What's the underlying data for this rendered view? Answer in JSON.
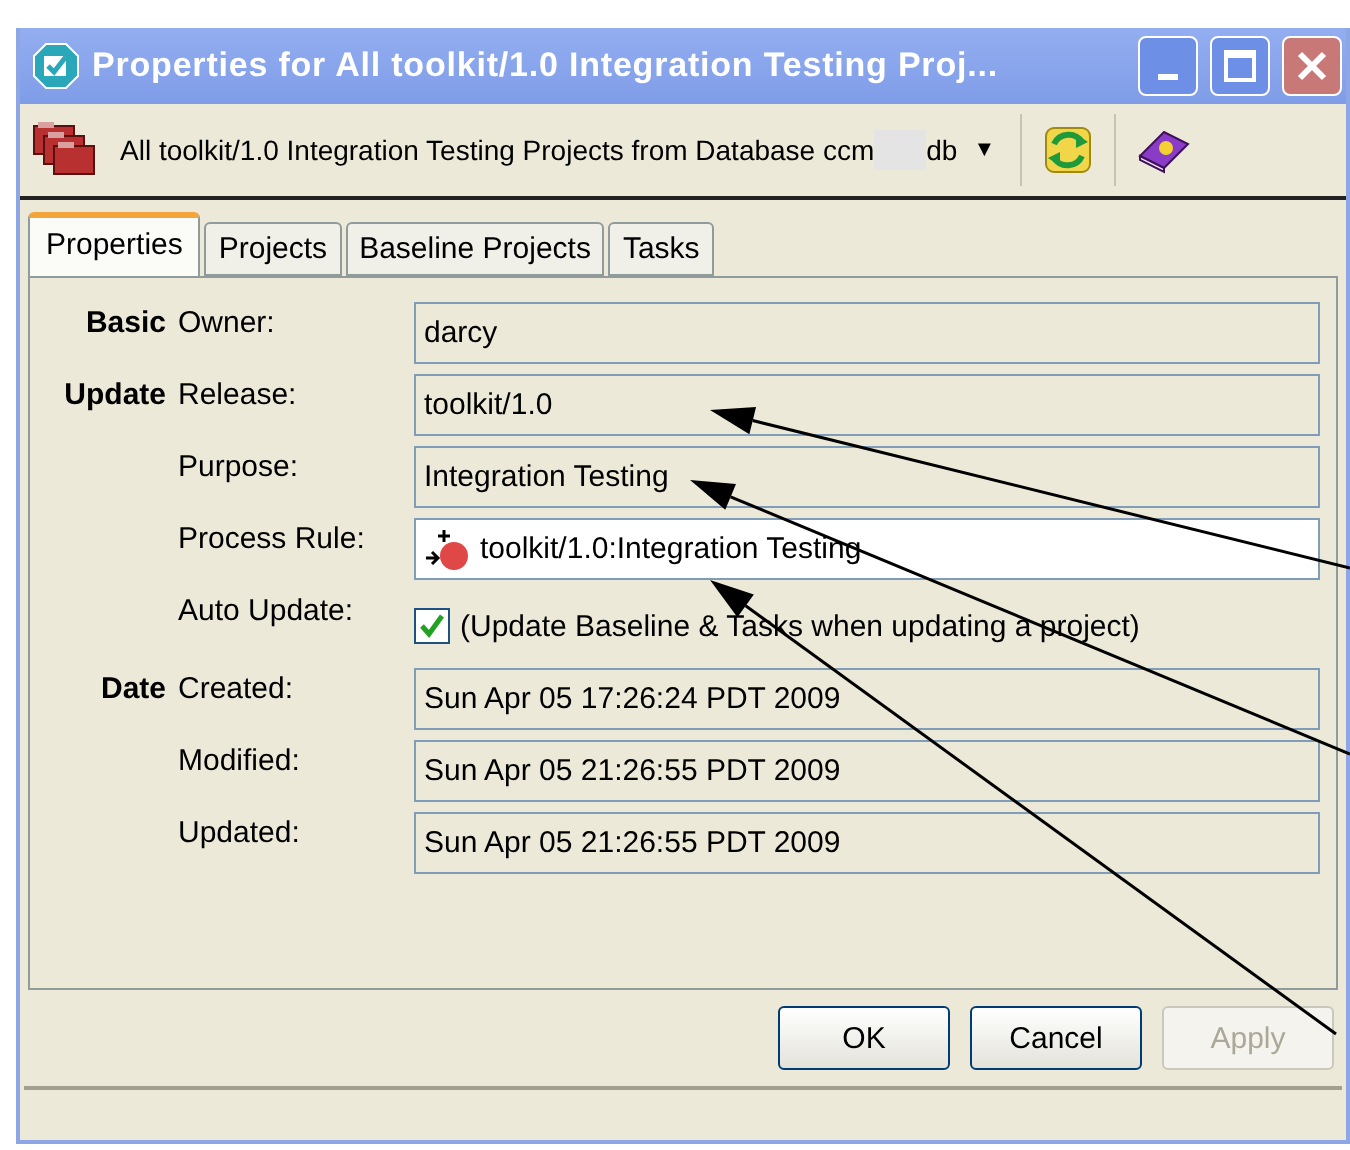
{
  "window": {
    "title": "Properties for All toolkit/1.0 Integration Testing Proj..."
  },
  "toolbar": {
    "selector_text": "All toolkit/1.0 Integration Testing Projects from Database ccm",
    "selector_suffix": "db",
    "dropdown_glyph": "▼"
  },
  "tabs": [
    {
      "label": "Properties",
      "selected": true
    },
    {
      "label": "Projects",
      "selected": false
    },
    {
      "label": "Baseline Projects",
      "selected": false
    },
    {
      "label": "Tasks",
      "selected": false
    }
  ],
  "groups": [
    {
      "heading": "Basic",
      "rows": [
        {
          "kind": "field",
          "label": "Owner:",
          "value": "darcy",
          "editable": false
        }
      ]
    },
    {
      "heading": "Update",
      "rows": [
        {
          "kind": "field",
          "label": "Release:",
          "value": "toolkit/1.0",
          "editable": false
        },
        {
          "kind": "field",
          "label": "Purpose:",
          "value": "Integration Testing",
          "editable": false
        },
        {
          "kind": "rule",
          "label": "Process Rule:",
          "value": "toolkit/1.0:Integration Testing",
          "editable": true
        },
        {
          "kind": "checkbox",
          "label": "Auto Update:",
          "value": "(Update Baseline & Tasks when updating a project)",
          "checked": true
        }
      ]
    },
    {
      "heading": "Date",
      "rows": [
        {
          "kind": "field",
          "label": "Created:",
          "value": "Sun Apr 05 17:26:24 PDT 2009",
          "editable": false
        },
        {
          "kind": "field",
          "label": "Modified:",
          "value": "Sun Apr 05 21:26:55 PDT 2009",
          "editable": false
        },
        {
          "kind": "field",
          "label": "Updated:",
          "value": "Sun Apr 05 21:26:55 PDT 2009",
          "editable": false
        }
      ]
    }
  ],
  "buttons": [
    {
      "label": "OK",
      "disabled": false
    },
    {
      "label": "Cancel",
      "disabled": false
    },
    {
      "label": "Apply",
      "disabled": true
    }
  ]
}
